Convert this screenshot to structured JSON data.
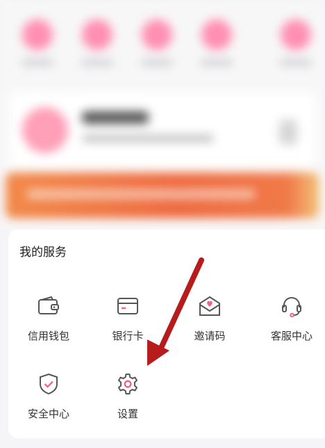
{
  "app": {
    "background": "#f5f5f7",
    "accent": "#f0648c",
    "arrow_color": "#b71c1c"
  },
  "top_area": {
    "blurred": true,
    "quick_actions_count": 5,
    "banner_colors": [
      "#f28a4a",
      "#ee6a40",
      "#f3c27a"
    ]
  },
  "services": {
    "title": "我的服务",
    "items": [
      {
        "label": "信用钱包",
        "icon": "wallet-icon"
      },
      {
        "label": "银行卡",
        "icon": "bank-card-icon"
      },
      {
        "label": "邀请码",
        "icon": "invite-envelope-icon"
      },
      {
        "label": "客服中心",
        "icon": "headset-icon"
      },
      {
        "label": "安全中心",
        "icon": "shield-check-icon"
      },
      {
        "label": "设置",
        "icon": "gear-icon"
      }
    ]
  }
}
